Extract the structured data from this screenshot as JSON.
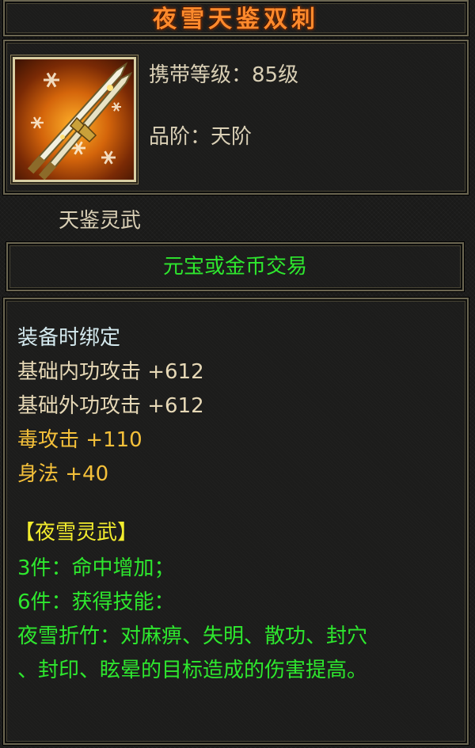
{
  "item": {
    "name": "夜雪天鉴双刺",
    "level_line": "携带等级：85级",
    "grade_line": "品阶：天阶",
    "icon": "twin-dagger-icon"
  },
  "set_group": "天鉴灵武",
  "trade": "元宝或金币交易",
  "attributes": {
    "bind": "装备时绑定",
    "inner_attack": "基础内功攻击 +612",
    "outer_attack": "基础外功攻击 +612",
    "poison_attack": "毒攻击 +110",
    "agility": "身法 +40"
  },
  "set_bonus": {
    "title": "【夜雪灵武】",
    "bonus_3": "3件：命中增加；",
    "bonus_6": "6件：获得技能：",
    "skill_line1": "夜雪折竹：对麻痹、失明、散功、封穴",
    "skill_line2": "、封印、眩晕的目标造成的伤害提高。"
  },
  "colors": {
    "title": "#ff8a2c",
    "trade": "#2ee82e",
    "set_text": "#2ee82e",
    "set_title": "#f2ec2e",
    "special_stat": "#f4c03a"
  }
}
